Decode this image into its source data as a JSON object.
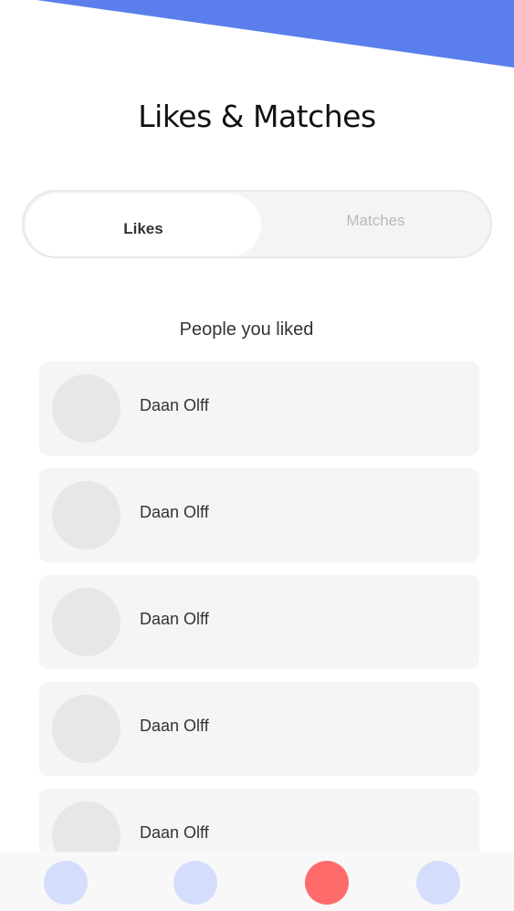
{
  "header": {
    "title": "Likes & Matches",
    "accent_color": "#5a7fec"
  },
  "tabs": [
    {
      "label": "Likes",
      "active": true
    },
    {
      "label": "Matches",
      "active": false
    }
  ],
  "section": {
    "label": "People you liked"
  },
  "people": [
    {
      "name": "Daan Olff"
    },
    {
      "name": "Daan Olff"
    },
    {
      "name": "Daan Olff"
    },
    {
      "name": "Daan Olff"
    },
    {
      "name": "Daan Olff"
    }
  ],
  "nav": {
    "items": [
      {
        "icon": "nav-circle-icon",
        "color": "#d5ddfc"
      },
      {
        "icon": "nav-circle-icon",
        "color": "#d5ddfc"
      },
      {
        "icon": "nav-circle-icon",
        "color": "#ff6b6b",
        "active": true
      },
      {
        "icon": "nav-circle-icon",
        "color": "#d5ddfc"
      }
    ]
  }
}
